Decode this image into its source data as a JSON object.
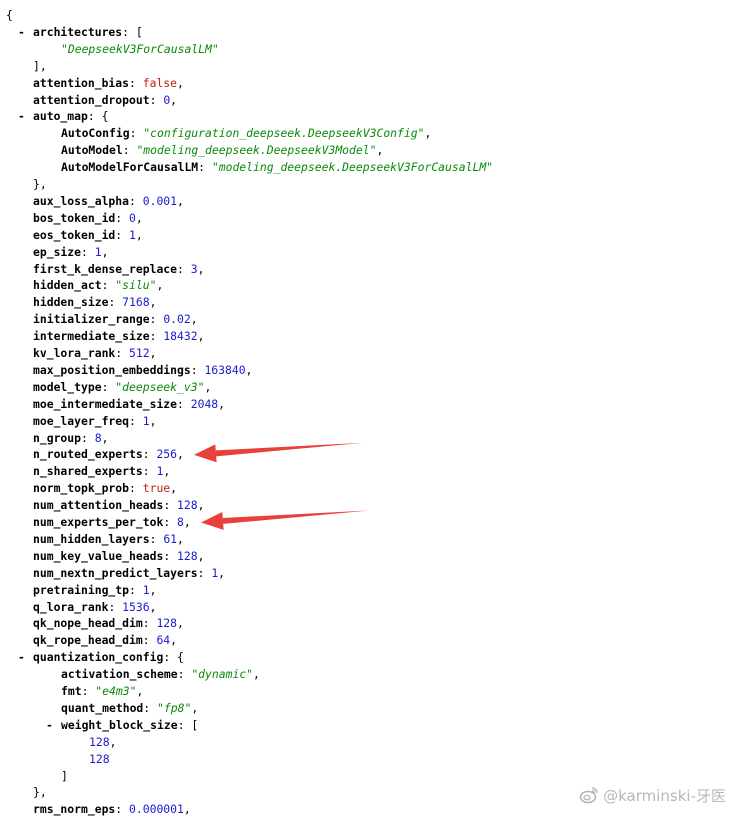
{
  "colors": {
    "key": "#000000",
    "string": "#0a8a0a",
    "number": "#1a1ad0",
    "boolean": "#c41a16",
    "arrow": "#e8403b"
  },
  "lines": [
    {
      "indent": 0,
      "open": "{"
    },
    {
      "indent": 1,
      "toggle": true,
      "key": "architectures",
      "open": "["
    },
    {
      "indent": 2,
      "value": "\"DeepseekV3ForCausalLM\"",
      "type": "string"
    },
    {
      "indent": 1,
      "close": "],"
    },
    {
      "indent": 1,
      "key": "attention_bias",
      "value": "false",
      "type": "boolean",
      "comma": true
    },
    {
      "indent": 1,
      "key": "attention_dropout",
      "value": "0",
      "type": "number",
      "comma": true
    },
    {
      "indent": 1,
      "toggle": true,
      "key": "auto_map",
      "open": "{"
    },
    {
      "indent": 2,
      "key": "AutoConfig",
      "value": "\"configuration_deepseek.DeepseekV3Config\"",
      "type": "string",
      "comma": true
    },
    {
      "indent": 2,
      "key": "AutoModel",
      "value": "\"modeling_deepseek.DeepseekV3Model\"",
      "type": "string",
      "comma": true
    },
    {
      "indent": 2,
      "key": "AutoModelForCausalLM",
      "value": "\"modeling_deepseek.DeepseekV3ForCausalLM\"",
      "type": "string"
    },
    {
      "indent": 1,
      "close": "},"
    },
    {
      "indent": 1,
      "key": "aux_loss_alpha",
      "value": "0.001",
      "type": "number",
      "comma": true
    },
    {
      "indent": 1,
      "key": "bos_token_id",
      "value": "0",
      "type": "number",
      "comma": true
    },
    {
      "indent": 1,
      "key": "eos_token_id",
      "value": "1",
      "type": "number",
      "comma": true
    },
    {
      "indent": 1,
      "key": "ep_size",
      "value": "1",
      "type": "number",
      "comma": true
    },
    {
      "indent": 1,
      "key": "first_k_dense_replace",
      "value": "3",
      "type": "number",
      "comma": true
    },
    {
      "indent": 1,
      "key": "hidden_act",
      "value": "\"silu\"",
      "type": "string",
      "comma": true
    },
    {
      "indent": 1,
      "key": "hidden_size",
      "value": "7168",
      "type": "number",
      "comma": true
    },
    {
      "indent": 1,
      "key": "initializer_range",
      "value": "0.02",
      "type": "number",
      "comma": true
    },
    {
      "indent": 1,
      "key": "intermediate_size",
      "value": "18432",
      "type": "number",
      "comma": true
    },
    {
      "indent": 1,
      "key": "kv_lora_rank",
      "value": "512",
      "type": "number",
      "comma": true
    },
    {
      "indent": 1,
      "key": "max_position_embeddings",
      "value": "163840",
      "type": "number",
      "comma": true
    },
    {
      "indent": 1,
      "key": "model_type",
      "value": "\"deepseek_v3\"",
      "type": "string",
      "comma": true
    },
    {
      "indent": 1,
      "key": "moe_intermediate_size",
      "value": "2048",
      "type": "number",
      "comma": true
    },
    {
      "indent": 1,
      "key": "moe_layer_freq",
      "value": "1",
      "type": "number",
      "comma": true
    },
    {
      "indent": 1,
      "key": "n_group",
      "value": "8",
      "type": "number",
      "comma": true
    },
    {
      "indent": 1,
      "key": "n_routed_experts",
      "value": "256",
      "type": "number",
      "comma": true,
      "arrow": true
    },
    {
      "indent": 1,
      "key": "n_shared_experts",
      "value": "1",
      "type": "number",
      "comma": true
    },
    {
      "indent": 1,
      "key": "norm_topk_prob",
      "value": "true",
      "type": "boolean",
      "comma": true
    },
    {
      "indent": 1,
      "key": "num_attention_heads",
      "value": "128",
      "type": "number",
      "comma": true
    },
    {
      "indent": 1,
      "key": "num_experts_per_tok",
      "value": "8",
      "type": "number",
      "comma": true,
      "arrow": true
    },
    {
      "indent": 1,
      "key": "num_hidden_layers",
      "value": "61",
      "type": "number",
      "comma": true
    },
    {
      "indent": 1,
      "key": "num_key_value_heads",
      "value": "128",
      "type": "number",
      "comma": true
    },
    {
      "indent": 1,
      "key": "num_nextn_predict_layers",
      "value": "1",
      "type": "number",
      "comma": true
    },
    {
      "indent": 1,
      "key": "pretraining_tp",
      "value": "1",
      "type": "number",
      "comma": true
    },
    {
      "indent": 1,
      "key": "q_lora_rank",
      "value": "1536",
      "type": "number",
      "comma": true
    },
    {
      "indent": 1,
      "key": "qk_nope_head_dim",
      "value": "128",
      "type": "number",
      "comma": true
    },
    {
      "indent": 1,
      "key": "qk_rope_head_dim",
      "value": "64",
      "type": "number",
      "comma": true
    },
    {
      "indent": 1,
      "toggle": true,
      "key": "quantization_config",
      "open": "{"
    },
    {
      "indent": 2,
      "key": "activation_scheme",
      "value": "\"dynamic\"",
      "type": "string",
      "comma": true
    },
    {
      "indent": 2,
      "key": "fmt",
      "value": "\"e4m3\"",
      "type": "string",
      "comma": true
    },
    {
      "indent": 2,
      "key": "quant_method",
      "value": "\"fp8\"",
      "type": "string",
      "comma": true
    },
    {
      "indent": 2,
      "toggle": true,
      "key": "weight_block_size",
      "open": "["
    },
    {
      "indent": 3,
      "value": "128",
      "type": "number",
      "comma": true
    },
    {
      "indent": 3,
      "value": "128",
      "type": "number"
    },
    {
      "indent": 2,
      "close": "]"
    },
    {
      "indent": 1,
      "close": "},"
    },
    {
      "indent": 1,
      "key": "rms_norm_eps",
      "value": "0.000001",
      "type": "number",
      "comma": true
    }
  ],
  "watermark": {
    "text": "@karminski-牙医",
    "icon": "weibo-icon"
  }
}
